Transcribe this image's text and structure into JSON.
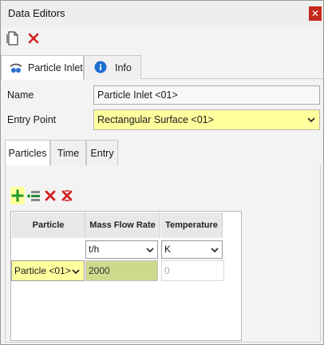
{
  "window": {
    "title": "Data Editors",
    "close_label": "✕"
  },
  "toolbar": {
    "new_icon": "new-document-icon",
    "delete_icon": "delete-icon"
  },
  "top_tabs": [
    {
      "label": "Particle Inlet",
      "icon": "particle-inlet-icon",
      "active": true
    },
    {
      "label": "Info",
      "icon": "info-icon",
      "active": false
    }
  ],
  "form": {
    "name_label": "Name",
    "name_value": "Particle Inlet <01>",
    "entry_point_label": "Entry Point",
    "entry_point_value": "Rectangular Surface <01>"
  },
  "sub_tabs": [
    {
      "label": "Particles",
      "active": true
    },
    {
      "label": "Time",
      "active": false
    },
    {
      "label": "Entry",
      "active": false
    }
  ],
  "grid_toolbar": {
    "add_icon": "add-icon",
    "insert_icon": "insert-row-icon",
    "remove_icon": "remove-icon",
    "remove_all_icon": "remove-all-icon"
  },
  "grid": {
    "headers": [
      "Particle",
      "Mass Flow Rate",
      "Temperature"
    ],
    "units": {
      "mass_flow_rate": "t/h",
      "temperature": "K"
    },
    "rows": [
      {
        "particle": "Particle <01>",
        "mass_flow_rate": "2000",
        "temperature": "0"
      }
    ]
  },
  "colors": {
    "highlight": "#ffff9e",
    "selected_cell": "#cfd98c",
    "close_button": "#c42b1c"
  }
}
